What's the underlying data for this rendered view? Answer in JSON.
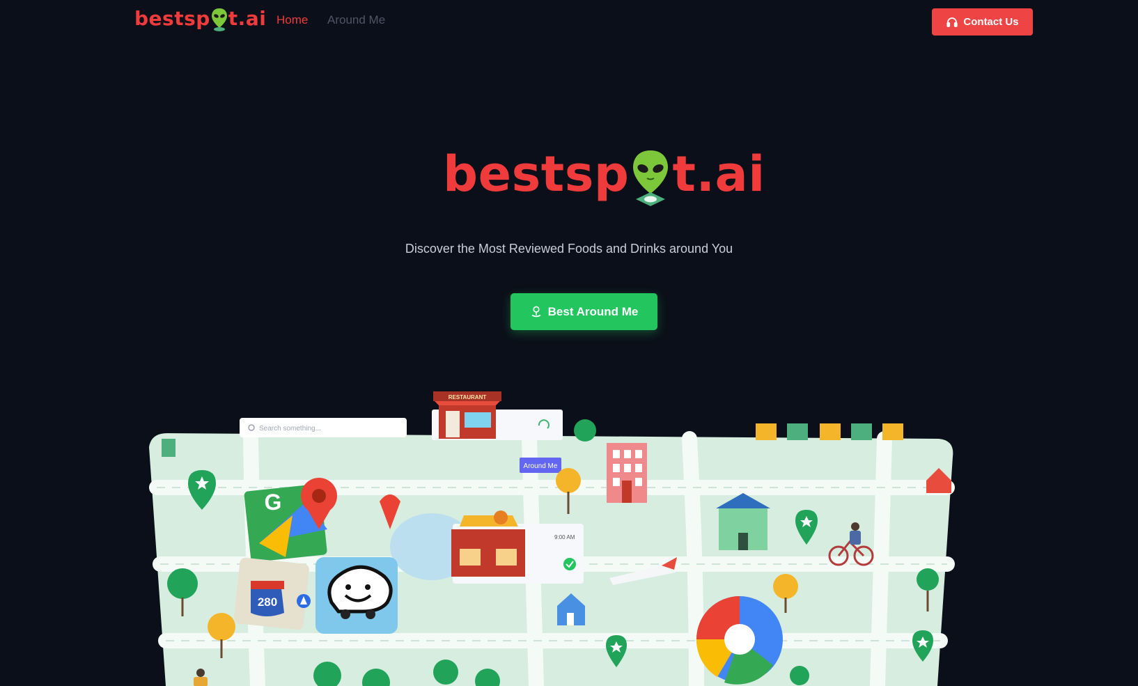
{
  "nav": {
    "logo": "bestsp",
    "logo_suffix": "t.ai",
    "links": [
      {
        "label": "Home",
        "active": true
      },
      {
        "label": "Around Me",
        "active": false
      }
    ],
    "contact_label": "Contact Us"
  },
  "hero": {
    "logo": "bestsp",
    "logo_suffix": "t.ai",
    "tagline": "Discover the Most Reviewed Foods and Drinks around You",
    "cta_label": "Best Around Me"
  },
  "illustration": {
    "search_placeholder": "Search something...",
    "restaurant_sign": "RESTAURANT",
    "around_me_tag": "Around Me",
    "time": "9:00 AM",
    "highway": "280"
  },
  "colors": {
    "background": "#0b0f19",
    "brand_red": "#ef4444",
    "cta_green": "#22c55e",
    "map_bg": "#d6ede0"
  }
}
